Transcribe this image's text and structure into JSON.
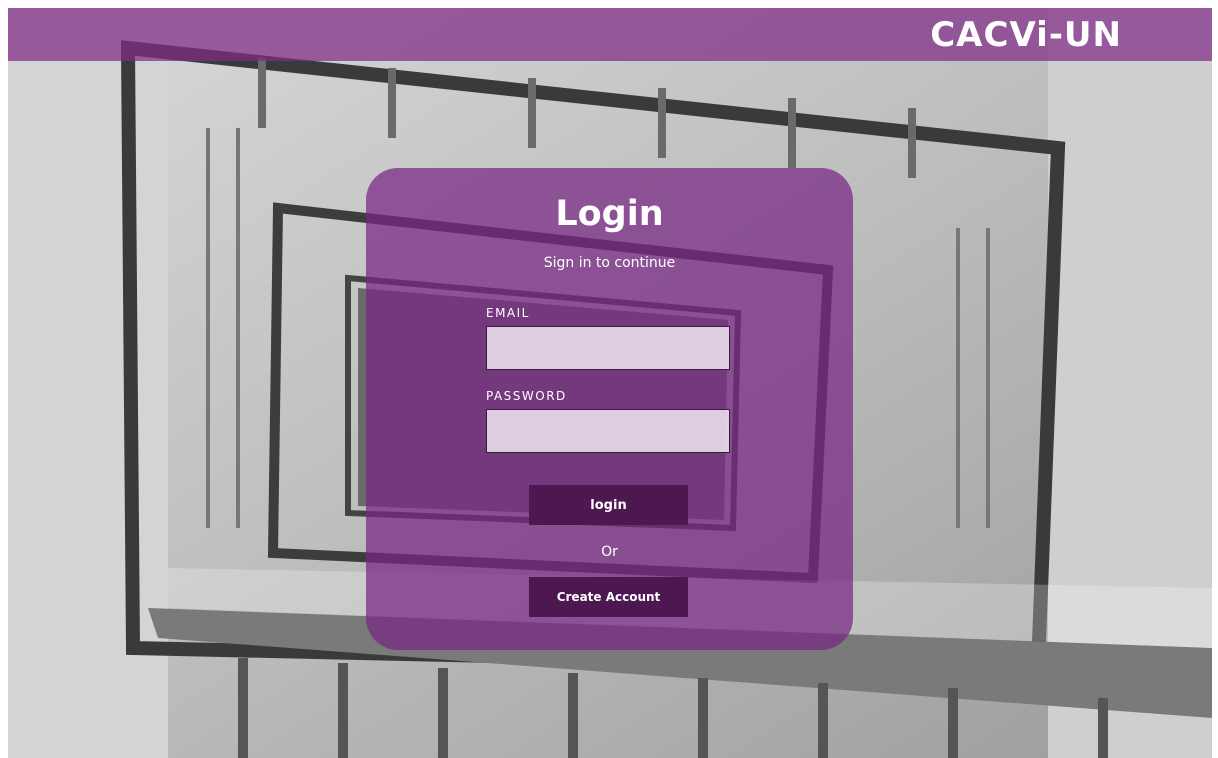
{
  "header": {
    "brand": "CACVi-UN",
    "bar_color": "#802d88"
  },
  "login_card": {
    "title": "Login",
    "subtitle": "Sign in to continue",
    "email_label": "EMAIL",
    "email_value": "",
    "email_placeholder": "",
    "password_label": "PASSWORD",
    "password_value": "",
    "password_placeholder": "",
    "login_button": "login",
    "or_text": "Or",
    "create_account_button": "Create Account",
    "card_color": "#762682",
    "button_color": "#4d1752"
  },
  "background": {
    "image_subject": "grayscale-stairwell-photo"
  }
}
